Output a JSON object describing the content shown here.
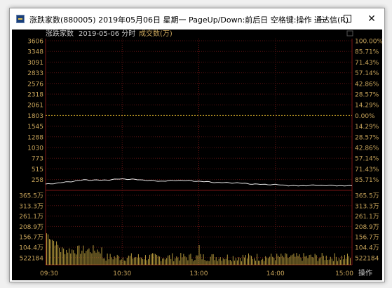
{
  "window": {
    "title": "涨跌家数(880005) 2019年05月06日 星期一 PageUp/Down:前后日 空格键:操作 通达信(R)",
    "minimize_icon": "minimize-icon",
    "maximize_icon": "maximize-icon",
    "close_icon": "close-icon"
  },
  "chart_header": {
    "name": "涨跌家数",
    "date_label": "2019-05-06 分时",
    "volume_label": "成交数(万)"
  },
  "colors": {
    "background": "#000000",
    "axis_text": "#c8a45a",
    "grid": "#7a1515",
    "line": "#e8e8e8",
    "volume_bar": "#b59a3c",
    "baseline": "#c9a227"
  },
  "price_axis": {
    "left_labels": [
      "3606",
      "3348",
      "3091",
      "2833",
      "2576",
      "2318",
      "2061",
      "1803",
      "1545",
      "1288",
      "1030",
      "773",
      "515",
      "258"
    ],
    "right_labels": [
      "100.00%",
      "85.71%",
      "71.43%",
      "57.14%",
      "42.86%",
      "28.57%",
      "14.29%",
      "0.00%",
      "14.29%",
      "28.57%",
      "42.86%",
      "57.14%",
      "71.43%",
      "85.71%"
    ]
  },
  "volume_axis": {
    "left_labels": [
      "365.5万",
      "313.3万",
      "261.1万",
      "208.9万",
      "156.7万",
      "104.4万",
      "522184"
    ],
    "right_labels": [
      "365.5万",
      "313.3万",
      "261.1万",
      "208.9万",
      "156.7万",
      "104.4万",
      "522184"
    ]
  },
  "time_axis": {
    "labels": [
      "09:30",
      "10:30",
      "13:00",
      "14:00",
      "15:00"
    ],
    "operate_button": "操作"
  },
  "chart_data": {
    "type": "line",
    "title": "涨跌家数",
    "x": [
      "09:30",
      "09:45",
      "10:00",
      "10:15",
      "10:30",
      "10:45",
      "11:00",
      "11:15",
      "11:30/13:00",
      "13:15",
      "13:30",
      "13:45",
      "14:00",
      "14:15",
      "14:30",
      "14:45",
      "15:00"
    ],
    "series": [
      {
        "values": [
          110,
          170,
          240,
          230,
          270,
          240,
          200,
          230,
          200,
          160,
          150,
          110,
          100,
          60,
          80,
          70,
          60
        ]
      }
    ],
    "ylim": [
      258,
      3606
    ],
    "volume": {
      "ylim": [
        0,
        3655000
      ]
    }
  }
}
